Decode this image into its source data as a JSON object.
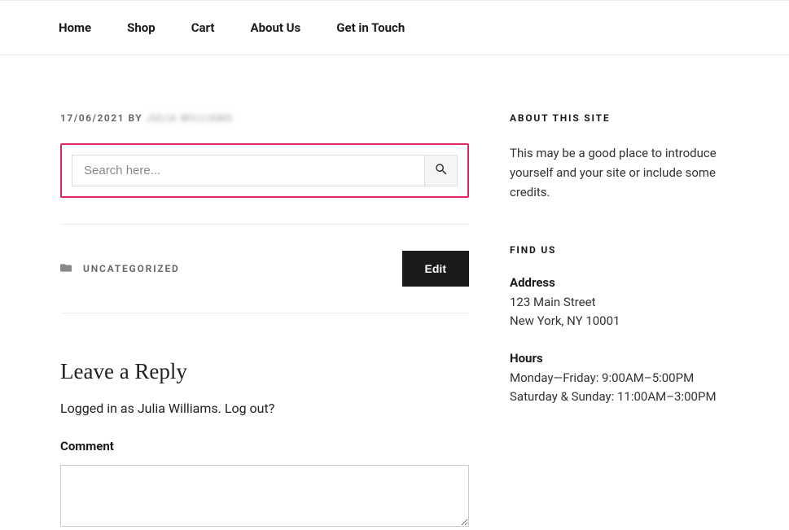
{
  "nav": {
    "items": [
      {
        "label": "Home"
      },
      {
        "label": "Shop"
      },
      {
        "label": "Cart"
      },
      {
        "label": "About Us"
      },
      {
        "label": "Get in Touch"
      }
    ]
  },
  "post": {
    "date": "17/06/2021",
    "by_label": "BY",
    "author": "JULIA WILLIAMS",
    "search_placeholder": "Search here...",
    "category": "UNCATEGORIZED",
    "edit_label": "Edit"
  },
  "reply": {
    "title": "Leave a Reply",
    "logged_in_prefix": "Logged in as ",
    "username": "Julia Williams",
    "logged_in_suffix": ". ",
    "logout_text": "Log out?",
    "comment_label": "Comment"
  },
  "sidebar": {
    "about_heading": "ABOUT THIS SITE",
    "about_text": "This may be a good place to introduce yourself and your site or include some credits.",
    "findus_heading": "FIND US",
    "address_label": "Address",
    "address_line1": "123 Main Street",
    "address_line2": "New York, NY 10001",
    "hours_label": "Hours",
    "hours_line1": "Monday—Friday: 9:00AM–5:00PM",
    "hours_line2": "Saturday & Sunday: 11:00AM–3:00PM"
  }
}
